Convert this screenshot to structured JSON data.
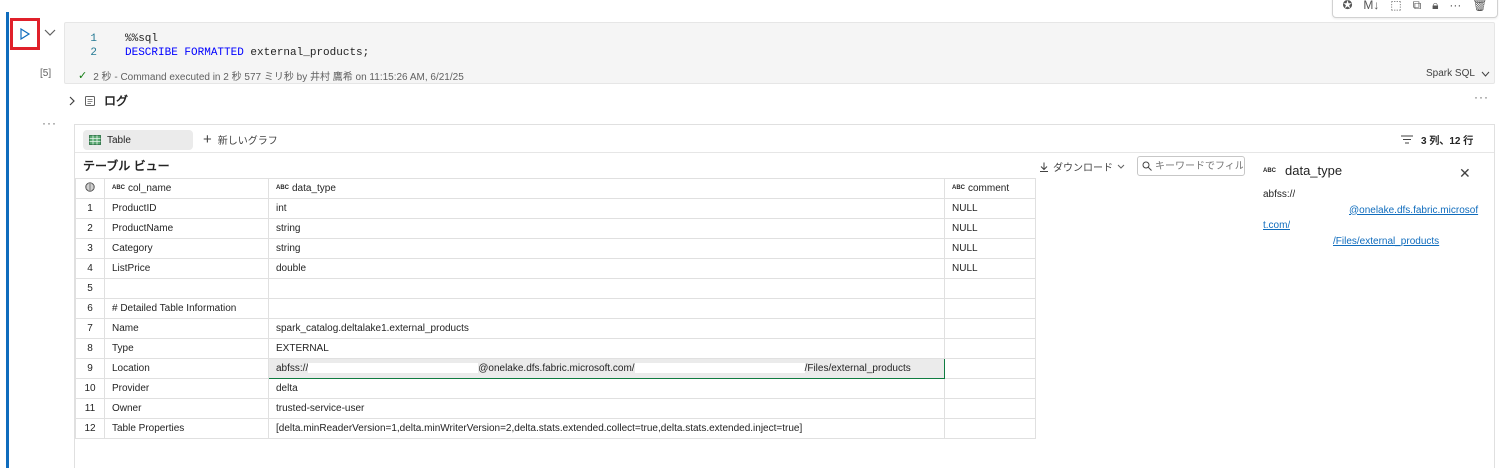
{
  "toolbar": {
    "icons": [
      "copilot-icon",
      "markdown-icon",
      "select-icon",
      "copy-icon",
      "lock-icon",
      "more-icon",
      "delete-icon"
    ],
    "markdown_label": "M↓",
    "more_label": "···"
  },
  "cell": {
    "line_numbers": [
      "1",
      "2"
    ],
    "line1": "%%sql",
    "line2_kw": "DESCRIBE FORMATTED",
    "line2_rest": " external_products;",
    "exec_count": "[5]",
    "status": "2 秒 - Command executed in 2 秒 577 ミリ秒 by 井村 鷹希 on 11:15:26 AM, 6/21/25",
    "language": "Spark SQL"
  },
  "log": {
    "label": "ログ",
    "more": "···"
  },
  "output_more": "···",
  "output": {
    "tab_table": "Table",
    "new_chart": "新しいグラフ",
    "rows_cols": "3 列、12 行",
    "view_title": "テーブル ビュー",
    "download": "ダウンロード",
    "search_placeholder": "キーワードでフィルター",
    "columns": [
      {
        "type": "ABC",
        "name": "col_name"
      },
      {
        "type": "ABC",
        "name": "data_type"
      },
      {
        "type": "ABC",
        "name": "comment"
      }
    ],
    "rows": [
      {
        "n": "1",
        "col_name": "ProductID",
        "data_type": "int",
        "comment": "NULL"
      },
      {
        "n": "2",
        "col_name": "ProductName",
        "data_type": "string",
        "comment": "NULL"
      },
      {
        "n": "3",
        "col_name": "Category",
        "data_type": "string",
        "comment": "NULL"
      },
      {
        "n": "4",
        "col_name": "ListPrice",
        "data_type": "double",
        "comment": "NULL"
      },
      {
        "n": "5",
        "col_name": "",
        "data_type": "",
        "comment": ""
      },
      {
        "n": "6",
        "col_name": "# Detailed Table Information",
        "data_type": "",
        "comment": ""
      },
      {
        "n": "7",
        "col_name": "Name",
        "data_type": "spark_catalog.deltalake1.external_products",
        "comment": ""
      },
      {
        "n": "8",
        "col_name": "Type",
        "data_type": "EXTERNAL",
        "comment": ""
      },
      {
        "n": "9",
        "col_name": "Location",
        "data_type": "",
        "comment": ""
      },
      {
        "n": "10",
        "col_name": "Provider",
        "data_type": "delta",
        "comment": ""
      },
      {
        "n": "11",
        "col_name": "Owner",
        "data_type": "trusted-service-user",
        "comment": ""
      },
      {
        "n": "12",
        "col_name": "Table Properties",
        "data_type": "[delta.minReaderVersion=1,delta.minWriterVersion=2,delta.stats.extended.collect=true,delta.stats.extended.inject=true]",
        "comment": ""
      }
    ],
    "location": {
      "prefix": "abfss://",
      "middle": "@onelake.dfs.fabric.microsoft.com/",
      "suffix": "/Files/external_products"
    }
  },
  "side_panel": {
    "type": "ABC",
    "title": "data_type",
    "value_prefix": "abfss://",
    "value_link_1": "@onelake.dfs.fabric.microsoft.com/",
    "value_link_2": "/Files/external_products"
  }
}
